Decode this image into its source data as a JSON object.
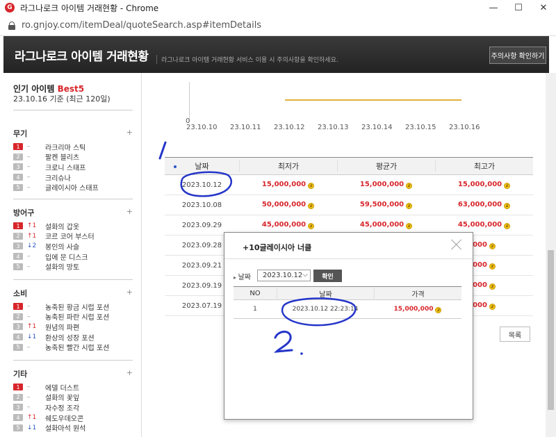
{
  "window": {
    "title": "라그나로크 아이템 거래현황 - Chrome",
    "app_icon": "G",
    "controls": [
      "—",
      "☐",
      "✕"
    ]
  },
  "address": {
    "url": "ro.gnjoy.com/itemDeal/quoteSearch.asp#itemDetails"
  },
  "header": {
    "title": "라그나로크 아이템 거래현황",
    "subtitle": "라그나로크 아이템 거래현황 서비스 이용 시 주의사항을 확인하세요.",
    "notice_button": "주의사항 확인하기"
  },
  "sidebar": {
    "popular_title": "인기 아이템",
    "popular_best": "Best5",
    "popular_date": "23.10.16 기준 (최근 120일)",
    "categories": [
      {
        "title": "무기",
        "items": [
          {
            "rank": "1",
            "change": "–",
            "dir": "none",
            "name": "라크리마 스틱"
          },
          {
            "rank": "2",
            "change": "–",
            "dir": "none",
            "name": "팔켄 블리츠"
          },
          {
            "rank": "3",
            "change": "–",
            "dir": "none",
            "name": "크로니 스태프"
          },
          {
            "rank": "4",
            "change": "–",
            "dir": "none",
            "name": "크리슈나"
          },
          {
            "rank": "5",
            "change": "–",
            "dir": "none",
            "name": "글레이시아 스태프"
          }
        ]
      },
      {
        "title": "방어구",
        "items": [
          {
            "rank": "1",
            "change": "↑1",
            "dir": "up",
            "name": "설화의 갑옷"
          },
          {
            "rank": "2",
            "change": "↑1",
            "dir": "up",
            "name": "코르 코어 부스터"
          },
          {
            "rank": "3",
            "change": "↓2",
            "dir": "down",
            "name": "봉인의 사슬"
          },
          {
            "rank": "4",
            "change": "–",
            "dir": "none",
            "name": "입에 문 디스크"
          },
          {
            "rank": "5",
            "change": "–",
            "dir": "none",
            "name": "설화의 망토"
          }
        ]
      },
      {
        "title": "소비",
        "items": [
          {
            "rank": "1",
            "change": "–",
            "dir": "none",
            "name": "농축된 황금 시럽 포션"
          },
          {
            "rank": "2",
            "change": "–",
            "dir": "none",
            "name": "농축된 파란 시럽 포션"
          },
          {
            "rank": "3",
            "change": "↑1",
            "dir": "up",
            "name": "원념의 파편"
          },
          {
            "rank": "4",
            "change": "↓1",
            "dir": "down",
            "name": "환상의 성장 포션"
          },
          {
            "rank": "5",
            "change": "–",
            "dir": "none",
            "name": "농축된 빨간 시럽 포션"
          }
        ]
      },
      {
        "title": "기타",
        "items": [
          {
            "rank": "1",
            "change": "–",
            "dir": "none",
            "name": "에델 더스트"
          },
          {
            "rank": "2",
            "change": "–",
            "dir": "none",
            "name": "설화의 꽃잎"
          },
          {
            "rank": "3",
            "change": "–",
            "dir": "none",
            "name": "자수정 조각"
          },
          {
            "rank": "4",
            "change": "↑1",
            "dir": "up",
            "name": "쉐도우데오콘"
          },
          {
            "rank": "5",
            "change": "↓1",
            "dir": "down",
            "name": "설화마석 원석"
          }
        ]
      }
    ]
  },
  "chart": {
    "y_zero": "0",
    "x_labels": [
      "23.10.10",
      "23.10.11",
      "23.10.12",
      "23.10.13",
      "23.10.14",
      "23.10.15",
      "23.10.16"
    ]
  },
  "table": {
    "headers": [
      "날짜",
      "최저가",
      "평균가",
      "최고가"
    ],
    "rows": [
      {
        "date": "2023.10.12",
        "min": "15,000,000",
        "avg": "15,000,000",
        "max": "15,000,000"
      },
      {
        "date": "2023.10.08",
        "min": "50,000,000",
        "avg": "59,500,000",
        "max": "63,000,000"
      },
      {
        "date": "2023.09.29",
        "min": "45,000,000",
        "avg": "45,000,000",
        "max": "45,000,000"
      },
      {
        "date": "2023.09.28",
        "min": "",
        "avg": "",
        "max": "000"
      },
      {
        "date": "2023.09.21",
        "min": "",
        "avg": "",
        "max": "000"
      },
      {
        "date": "2023.09.19",
        "min": "",
        "avg": "",
        "max": "000"
      },
      {
        "date": "2023.07.19",
        "min": "",
        "avg": "",
        "max": "000"
      }
    ],
    "list_button": "목록"
  },
  "modal": {
    "title": "+10글레이시아 너클",
    "date_label": "날짜",
    "date_value": "2023.10.12",
    "confirm_button": "확인",
    "headers": [
      "NO",
      "날짜",
      "가격"
    ],
    "rows": [
      {
        "no": "1",
        "datetime": "2023.10.12 22:23:14",
        "price": "15,000,000"
      }
    ]
  },
  "annotations": {
    "mark1": "1",
    "mark2": "2.",
    "ink_color": "#2435c9"
  }
}
